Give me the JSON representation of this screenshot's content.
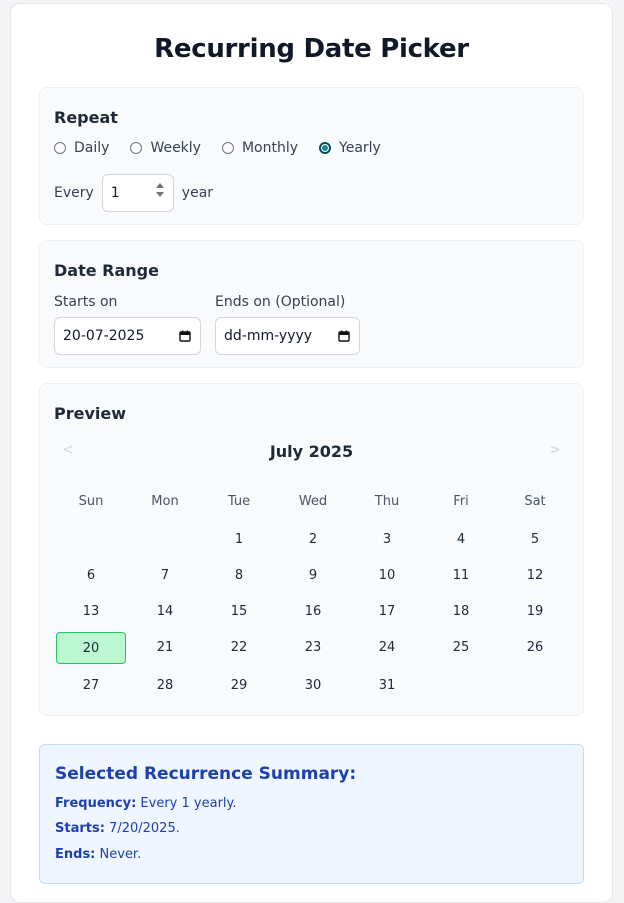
{
  "page": {
    "title": "Recurring Date Picker"
  },
  "repeat": {
    "heading": "Repeat",
    "options": [
      {
        "label": "Daily",
        "checked": false
      },
      {
        "label": "Weekly",
        "checked": false
      },
      {
        "label": "Monthly",
        "checked": false
      },
      {
        "label": "Yearly",
        "checked": true
      }
    ],
    "every_label": "Every",
    "interval_value": "1",
    "unit_label": "year"
  },
  "date_range": {
    "heading": "Date Range",
    "start_label": "Starts on",
    "start_value": "20-07-2025",
    "end_label": "Ends on (Optional)",
    "end_placeholder": "dd-mm-yyyy"
  },
  "preview": {
    "heading": "Preview",
    "month_label": "July 2025",
    "prev_arrow": "<",
    "next_arrow": ">",
    "weekdays": [
      "Sun",
      "Mon",
      "Tue",
      "Wed",
      "Thu",
      "Fri",
      "Sat"
    ],
    "first_weekday_index": 2,
    "days_in_month": 31,
    "selected_day": 20
  },
  "summary": {
    "title": "Selected Recurrence Summary:",
    "frequency_label": "Frequency:",
    "frequency_value": " Every 1 yearly.",
    "starts_label": "Starts:",
    "starts_value": " 7/20/2025.",
    "ends_label": "Ends:",
    "ends_value": " Never."
  },
  "colors": {
    "accent": "#0e8a96",
    "selected_day_bg": "#bbf7d0",
    "selected_day_border": "#22c55e",
    "summary_text": "#1e40af",
    "summary_bg": "#eff6ff"
  }
}
